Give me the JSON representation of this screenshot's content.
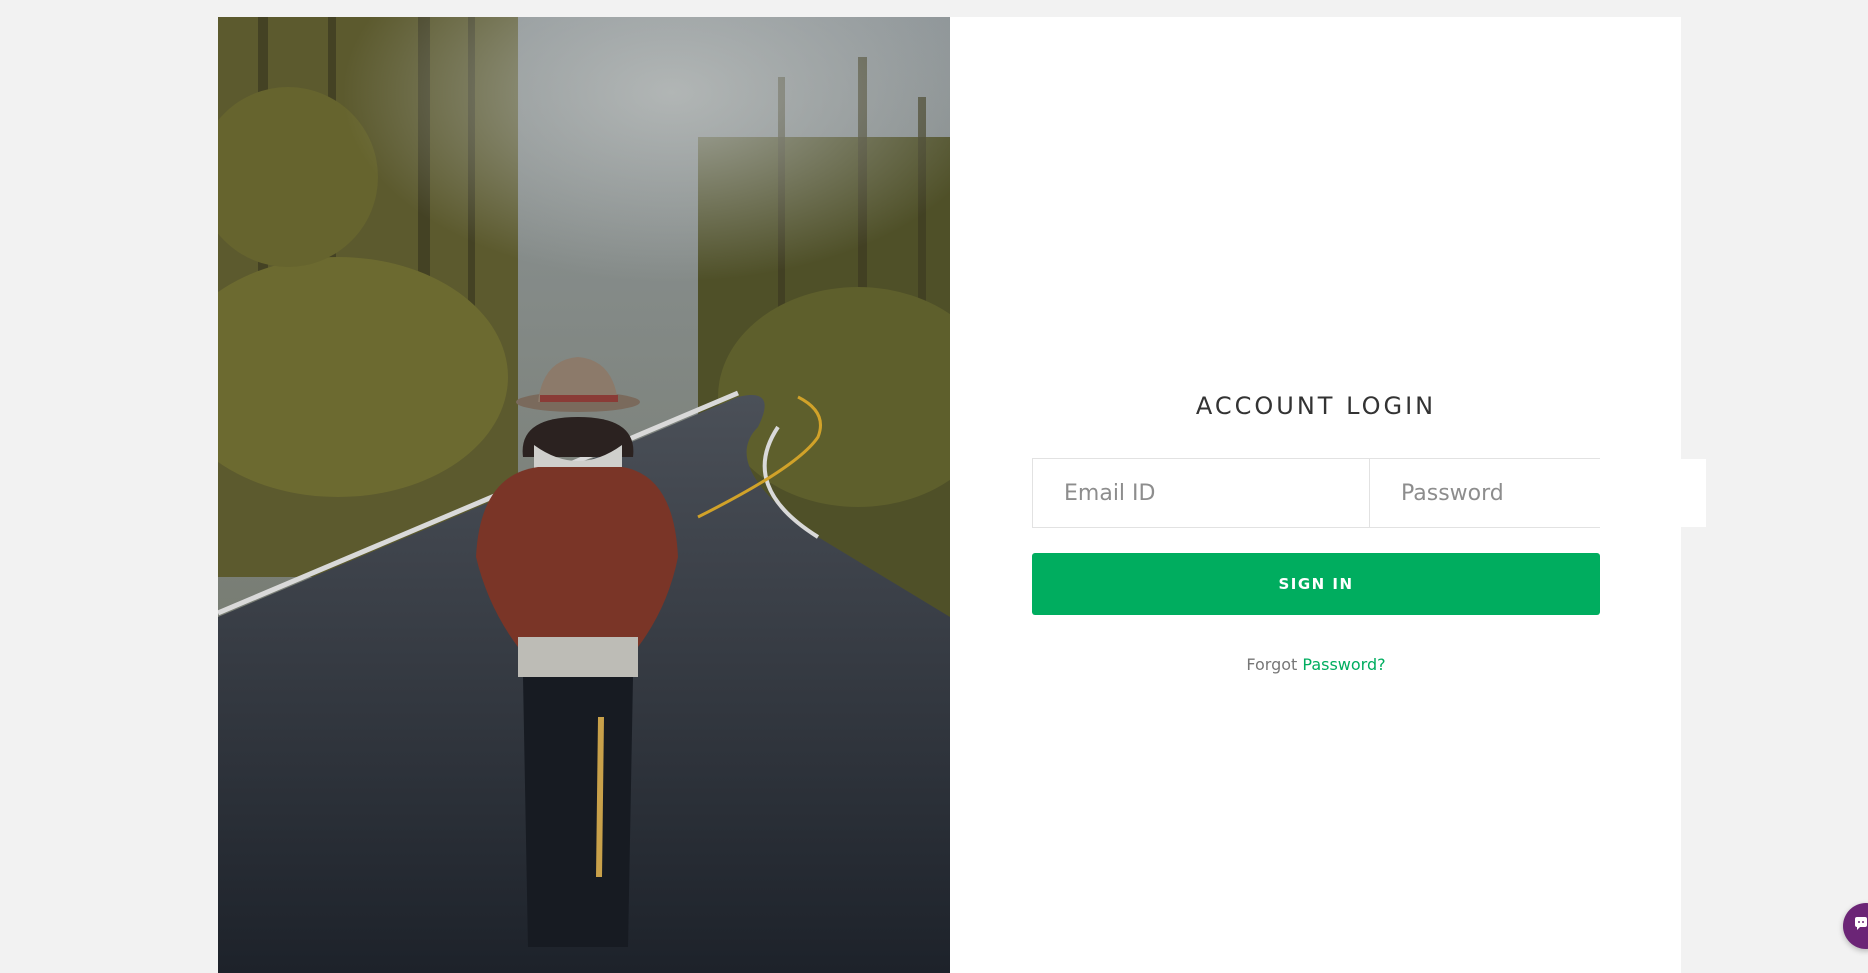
{
  "colors": {
    "accent": "#00ad5f",
    "page_bg": "#f2f2f2",
    "chat": "#6b2576"
  },
  "hero": {
    "image": "person-walking-on-forest-road"
  },
  "login": {
    "title": "ACCOUNT LOGIN",
    "email_placeholder": "Email ID",
    "email_value": "",
    "password_placeholder": "Password",
    "password_value": "",
    "signin_label": "SIGN IN",
    "forgot_prefix": "Forgot",
    "forgot_link": "Password?"
  },
  "chat_widget": {
    "icon": "chat-icon"
  }
}
